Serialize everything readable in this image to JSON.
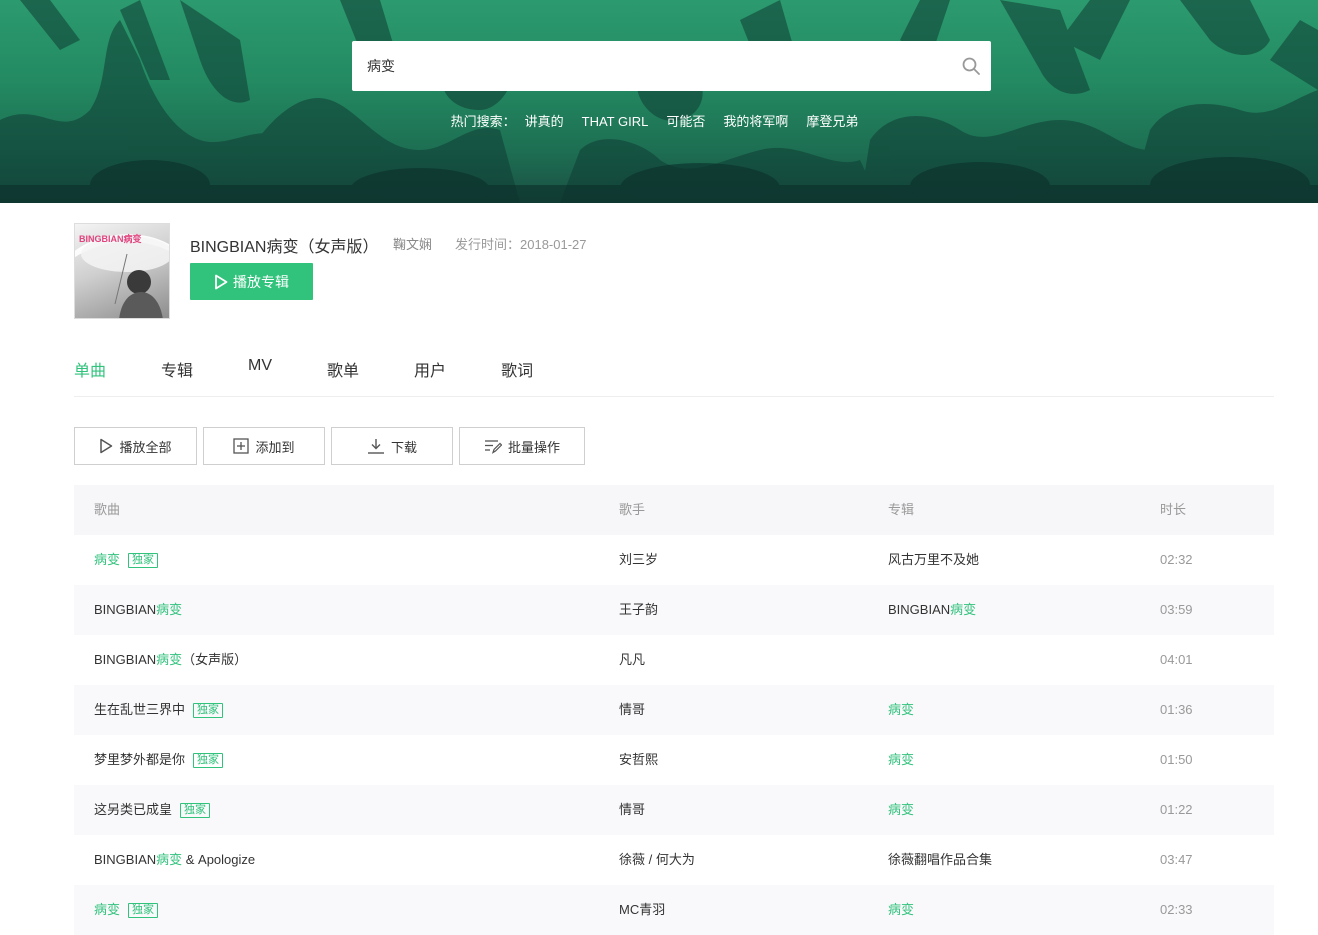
{
  "search": {
    "value": "病变",
    "placeholder": "",
    "hot_label": "热门搜索：",
    "hot_items": [
      "讲真的",
      "THAT GIRL",
      "可能否",
      "我的将军啊",
      "摩登兄弟"
    ]
  },
  "album": {
    "title": "BINGBIAN病变（女声版）",
    "artist": "鞠文娴",
    "release_label": "发行时间：",
    "release_date": "2018-01-27",
    "play_label": "播放专辑",
    "cover_text": "BINGBIAN病变"
  },
  "tabs": [
    {
      "label": "单曲",
      "active": true
    },
    {
      "label": "专辑",
      "active": false
    },
    {
      "label": "MV",
      "active": false
    },
    {
      "label": "歌单",
      "active": false
    },
    {
      "label": "用户",
      "active": false
    },
    {
      "label": "歌词",
      "active": false
    }
  ],
  "toolbar": {
    "play_all": "播放全部",
    "add_to": "添加到",
    "download": "下载",
    "batch": "批量操作"
  },
  "table": {
    "headers": {
      "song": "歌曲",
      "singer": "歌手",
      "album": "专辑",
      "duration": "时长"
    },
    "badge_label": "独家",
    "rows": [
      {
        "song_pre": "",
        "song_hl": "病变",
        "song_post": "",
        "exclusive": true,
        "singer": "刘三岁",
        "album_pre": "风古万里不及她",
        "album_hl": "",
        "duration": "02:32"
      },
      {
        "song_pre": "BINGBIAN",
        "song_hl": "病变",
        "song_post": "",
        "exclusive": false,
        "singer": "王子韵",
        "album_pre": "BINGBIAN",
        "album_hl": "病变",
        "duration": "03:59"
      },
      {
        "song_pre": "BINGBIAN",
        "song_hl": "病变",
        "song_post": "（女声版）",
        "exclusive": false,
        "singer": "凡凡",
        "album_pre": "",
        "album_hl": "",
        "duration": "04:01"
      },
      {
        "song_pre": "生在乱世三界中",
        "song_hl": "",
        "song_post": "",
        "exclusive": true,
        "singer": "情哥",
        "album_pre": "",
        "album_hl": "病变",
        "duration": "01:36"
      },
      {
        "song_pre": "梦里梦外都是你",
        "song_hl": "",
        "song_post": "",
        "exclusive": true,
        "singer": "安哲熙",
        "album_pre": "",
        "album_hl": "病变",
        "duration": "01:50"
      },
      {
        "song_pre": "这另类已成皇",
        "song_hl": "",
        "song_post": "",
        "exclusive": true,
        "singer": "情哥",
        "album_pre": "",
        "album_hl": "病变",
        "duration": "01:22"
      },
      {
        "song_pre": "BINGBIAN",
        "song_hl": "病变",
        "song_post": " & Apologize",
        "exclusive": false,
        "singer": "徐薇 / 何大为",
        "album_pre": "徐薇翻唱作品合集",
        "album_hl": "",
        "duration": "03:47"
      },
      {
        "song_pre": "",
        "song_hl": "病变",
        "song_post": "",
        "exclusive": true,
        "singer": "MC青羽",
        "album_pre": "",
        "album_hl": "病变",
        "duration": "02:33"
      }
    ]
  },
  "colors": {
    "accent": "#31c27c",
    "hero": "#238a62",
    "text": "#333333",
    "muted": "#999999"
  }
}
